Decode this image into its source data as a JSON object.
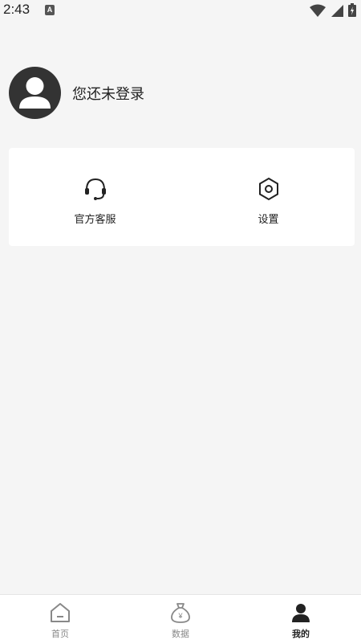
{
  "status_bar": {
    "time": "2:43",
    "notification_badge": "A",
    "icons": [
      "wifi-icon",
      "signal-icon",
      "battery-icon"
    ]
  },
  "profile": {
    "login_text": "您还未登录",
    "avatar_icon": "user-avatar-icon"
  },
  "card": {
    "items": [
      {
        "label": "官方客服",
        "icon": "headset-icon"
      },
      {
        "label": "设置",
        "icon": "hexagon-settings-icon"
      }
    ]
  },
  "tabbar": {
    "tabs": [
      {
        "label": "首页",
        "icon": "home-icon",
        "active": false
      },
      {
        "label": "数据",
        "icon": "money-bag-icon",
        "active": false
      },
      {
        "label": "我的",
        "icon": "person-icon",
        "active": true
      }
    ]
  },
  "colors": {
    "background": "#f5f5f5",
    "card": "#ffffff",
    "active_tab": "#222222",
    "inactive_tab": "#888888",
    "avatar_bg": "#333333"
  }
}
